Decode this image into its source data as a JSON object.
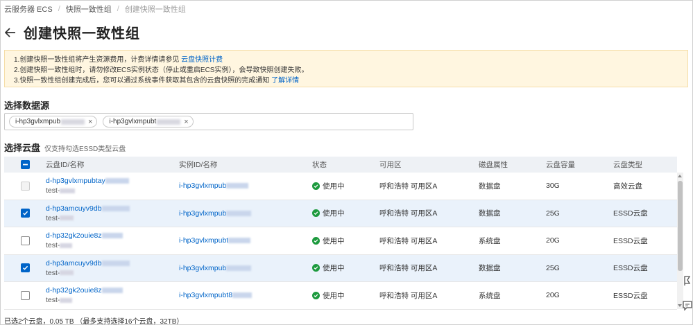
{
  "breadcrumb": [
    "云服务器 ECS",
    "快照一致性组",
    "创建快照一致性组"
  ],
  "page_title": "创建快照一致性组",
  "notice": {
    "line1_text": "1.创建快照一致性组将产生资源费用，计费详情请参见 ",
    "line1_link": "云盘快照计费",
    "line2_text": "2.创建快照一致性组时，请勿修改ECS实例状态（停止或重启ECS实例），会导致快照创建失败。",
    "line3_text": "3.快照一致性组创建完成后，您可以通过系统事件获取其包含的云盘快照的完成通知 ",
    "line3_link": "了解详情"
  },
  "source": {
    "label": "选择数据源",
    "tags": [
      "i-hp3gvlxmpub",
      "i-hp3gvlxmpubt"
    ]
  },
  "disk": {
    "label": "选择云盘",
    "hint": "仅支持勾选ESSD类型云盘"
  },
  "table": {
    "headers": [
      "云盘ID/名称",
      "实例ID/名称",
      "状态",
      "可用区",
      "磁盘属性",
      "云盘容量",
      "云盘类型"
    ],
    "rows": [
      {
        "checked": "disabled",
        "disk_id": "d-hp3gvlxmpubtay",
        "name": "test-",
        "instance": "i-hp3gvlxmpub",
        "status": "使用中",
        "zone": "呼和浩特 可用区A",
        "attr": "数据盘",
        "capacity": "30G",
        "type": "高效云盘"
      },
      {
        "checked": "true",
        "disk_id": "d-hp3amcuyv9db",
        "name": "test-",
        "instance": "i-hp3gvlxmpub",
        "status": "使用中",
        "zone": "呼和浩特 可用区A",
        "attr": "数据盘",
        "capacity": "25G",
        "type": "ESSD云盘"
      },
      {
        "checked": "false",
        "disk_id": "d-hp32gk2ouie8z",
        "name": "test-",
        "instance": "i-hp3gvlxmpubt",
        "status": "使用中",
        "zone": "呼和浩特 可用区A",
        "attr": "系统盘",
        "capacity": "20G",
        "type": "ESSD云盘"
      },
      {
        "checked": "true",
        "disk_id": "d-hp3amcuyv9db",
        "name": "test-",
        "instance": "i-hp3gvlxmpub",
        "status": "使用中",
        "zone": "呼和浩特 可用区A",
        "attr": "数据盘",
        "capacity": "25G",
        "type": "ESSD云盘"
      },
      {
        "checked": "false",
        "disk_id": "d-hp32gk2ouie8z",
        "name": "test-",
        "instance": "i-hp3gvlxmpubt8",
        "status": "使用中",
        "zone": "呼和浩特 可用区A",
        "attr": "系统盘",
        "capacity": "20G",
        "type": "ESSD云盘"
      }
    ]
  },
  "footer": "已选2个云盘，0.05 TB （最多支持选择16个云盘，32TB）",
  "colors": {
    "accent": "#0064c8",
    "success": "#1d9a3e",
    "notice_bg": "#fff6e0"
  }
}
